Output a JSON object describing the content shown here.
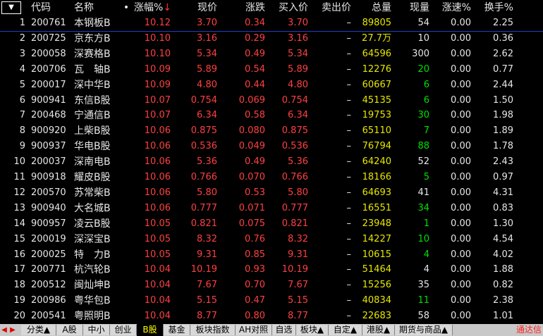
{
  "header": {
    "menu_icon": "down-triangle-icon",
    "columns": [
      "",
      "代码",
      "名称",
      "•",
      "涨幅%",
      "现价",
      "涨跌",
      "买入价",
      "卖出价",
      "总量",
      "现量",
      "涨速%",
      "换手%"
    ],
    "sort_indicator": "↓"
  },
  "colors": {
    "rise": "#ff4040",
    "flat": "#e6e6e6",
    "vol": "#e6e600",
    "up_tick": "#00e000",
    "code": "#e6e6e6",
    "name": "#e6e6e6"
  },
  "rows": [
    {
      "i": "1",
      "code": "200761",
      "name": "本钢板B",
      "chg": "10.12",
      "price": "3.70",
      "diff": "0.34",
      "bid": "3.70",
      "ask": "–",
      "vol": "89805",
      "cur": "54",
      "cur_up": false,
      "speed": "0.00",
      "turn": "2.25"
    },
    {
      "i": "2",
      "code": "200725",
      "name": "京东方B",
      "chg": "10.10",
      "price": "3.16",
      "diff": "0.29",
      "bid": "3.16",
      "ask": "–",
      "vol": "27.7万",
      "cur": "10",
      "cur_up": false,
      "speed": "0.00",
      "turn": "0.36"
    },
    {
      "i": "3",
      "code": "200058",
      "name": "深赛格B",
      "chg": "10.10",
      "price": "5.34",
      "diff": "0.49",
      "bid": "5.34",
      "ask": "–",
      "vol": "64596",
      "cur": "300",
      "cur_up": false,
      "speed": "0.00",
      "turn": "2.62"
    },
    {
      "i": "4",
      "code": "200706",
      "name": "瓦　轴B",
      "chg": "10.09",
      "price": "5.89",
      "diff": "0.54",
      "bid": "5.89",
      "ask": "–",
      "vol": "12276",
      "cur": "20",
      "cur_up": true,
      "speed": "0.00",
      "turn": "0.77"
    },
    {
      "i": "5",
      "code": "200017",
      "name": "深中华B",
      "chg": "10.09",
      "price": "4.80",
      "diff": "0.44",
      "bid": "4.80",
      "ask": "–",
      "vol": "60667",
      "cur": "6",
      "cur_up": true,
      "speed": "0.00",
      "turn": "2.44"
    },
    {
      "i": "6",
      "code": "900941",
      "name": "东信B股",
      "chg": "10.07",
      "price": "0.754",
      "diff": "0.069",
      "bid": "0.754",
      "ask": "–",
      "vol": "45135",
      "cur": "6",
      "cur_up": true,
      "speed": "0.00",
      "turn": "1.50"
    },
    {
      "i": "7",
      "code": "200468",
      "name": "宁通信B",
      "chg": "10.07",
      "price": "6.34",
      "diff": "0.58",
      "bid": "6.34",
      "ask": "–",
      "vol": "19753",
      "cur": "30",
      "cur_up": true,
      "speed": "0.00",
      "turn": "1.98"
    },
    {
      "i": "8",
      "code": "900920",
      "name": "上柴B股",
      "chg": "10.06",
      "price": "0.875",
      "diff": "0.080",
      "bid": "0.875",
      "ask": "–",
      "vol": "65110",
      "cur": "7",
      "cur_up": true,
      "speed": "0.00",
      "turn": "1.89"
    },
    {
      "i": "9",
      "code": "900937",
      "name": "华电B股",
      "chg": "10.06",
      "price": "0.536",
      "diff": "0.049",
      "bid": "0.536",
      "ask": "–",
      "vol": "76794",
      "cur": "88",
      "cur_up": true,
      "speed": "0.00",
      "turn": "1.78"
    },
    {
      "i": "10",
      "code": "200037",
      "name": "深南电B",
      "chg": "10.06",
      "price": "5.36",
      "diff": "0.49",
      "bid": "5.36",
      "ask": "–",
      "vol": "64240",
      "cur": "52",
      "cur_up": false,
      "speed": "0.00",
      "turn": "2.43"
    },
    {
      "i": "11",
      "code": "900918",
      "name": "耀皮B股",
      "chg": "10.06",
      "price": "0.766",
      "diff": "0.070",
      "bid": "0.766",
      "ask": "–",
      "vol": "18166",
      "cur": "5",
      "cur_up": true,
      "speed": "0.00",
      "turn": "0.97"
    },
    {
      "i": "12",
      "code": "200570",
      "name": "苏常柴B",
      "chg": "10.06",
      "price": "5.80",
      "diff": "0.53",
      "bid": "5.80",
      "ask": "–",
      "vol": "64693",
      "cur": "41",
      "cur_up": false,
      "speed": "0.00",
      "turn": "4.31"
    },
    {
      "i": "13",
      "code": "900940",
      "name": "大名城B",
      "chg": "10.06",
      "price": "0.777",
      "diff": "0.071",
      "bid": "0.777",
      "ask": "–",
      "vol": "16551",
      "cur": "34",
      "cur_up": true,
      "speed": "0.00",
      "turn": "0.83"
    },
    {
      "i": "14",
      "code": "900957",
      "name": "凌云B股",
      "chg": "10.05",
      "price": "0.821",
      "diff": "0.075",
      "bid": "0.821",
      "ask": "–",
      "vol": "23948",
      "cur": "1",
      "cur_up": true,
      "speed": "0.00",
      "turn": "1.30"
    },
    {
      "i": "15",
      "code": "200019",
      "name": "深深宝B",
      "chg": "10.05",
      "price": "8.32",
      "diff": "0.76",
      "bid": "8.32",
      "ask": "–",
      "vol": "14227",
      "cur": "10",
      "cur_up": true,
      "speed": "0.00",
      "turn": "4.54"
    },
    {
      "i": "16",
      "code": "200025",
      "name": "特　力B",
      "chg": "10.05",
      "price": "9.31",
      "diff": "0.85",
      "bid": "9.31",
      "ask": "–",
      "vol": "10615",
      "cur": "4",
      "cur_up": true,
      "speed": "0.00",
      "turn": "4.02"
    },
    {
      "i": "17",
      "code": "200771",
      "name": "杭汽轮B",
      "chg": "10.04",
      "price": "10.19",
      "diff": "0.93",
      "bid": "10.19",
      "ask": "–",
      "vol": "51464",
      "cur": "4",
      "cur_up": false,
      "speed": "0.00",
      "turn": "1.88"
    },
    {
      "i": "18",
      "code": "200512",
      "name": "闽灿坤B",
      "chg": "10.04",
      "price": "7.67",
      "diff": "0.70",
      "bid": "7.67",
      "ask": "–",
      "vol": "15256",
      "cur": "35",
      "cur_up": false,
      "speed": "0.00",
      "turn": "0.82"
    },
    {
      "i": "19",
      "code": "200986",
      "name": "粤华包B",
      "chg": "10.04",
      "price": "5.15",
      "diff": "0.47",
      "bid": "5.15",
      "ask": "–",
      "vol": "40834",
      "cur": "11",
      "cur_up": true,
      "speed": "0.00",
      "turn": "2.38"
    },
    {
      "i": "20",
      "code": "200541",
      "name": "粤照明B",
      "chg": "10.04",
      "price": "8.77",
      "diff": "0.80",
      "bid": "8.77",
      "ask": "–",
      "vol": "22683",
      "cur": "58",
      "cur_up": false,
      "speed": "0.00",
      "turn": "1.01"
    }
  ],
  "tabbar": {
    "nav_left": "◀",
    "nav_right": "▶",
    "tabs": [
      "分类▲",
      "A股",
      "中小",
      "创业",
      "B股",
      "基金",
      "板块指数",
      "AH对照",
      "自选",
      "板块▲",
      "自定▲",
      "港股▲",
      "期货与商品▲"
    ],
    "active_index": 4,
    "brand": "通达信"
  }
}
